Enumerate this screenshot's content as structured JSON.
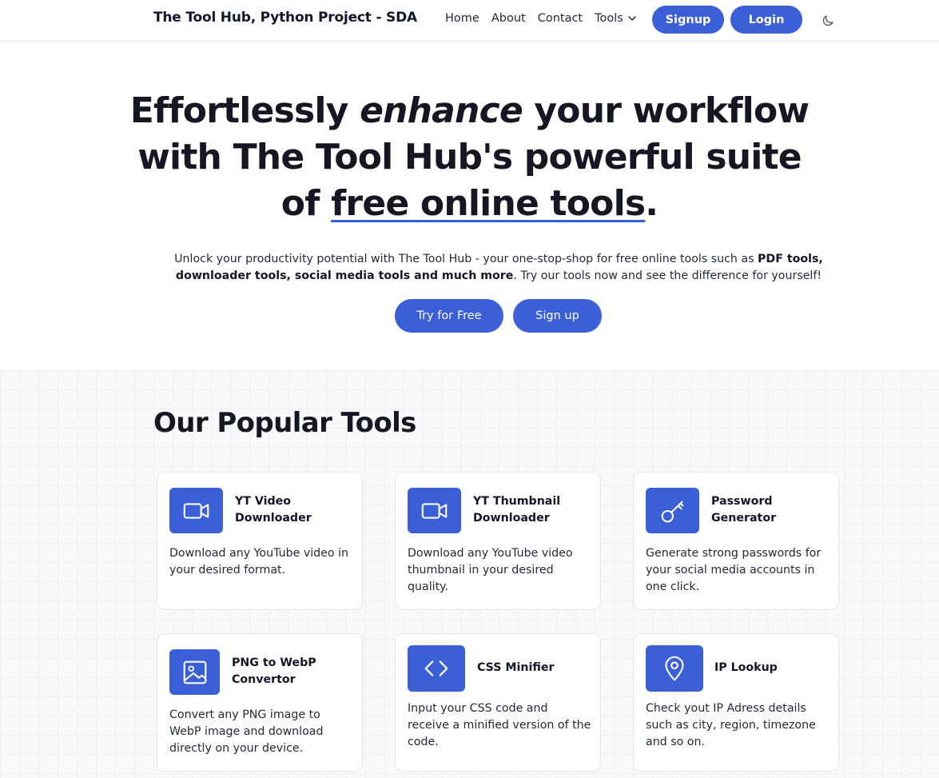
{
  "navbar": {
    "brand": "The Tool Hub, Python Project - SDA",
    "links": [
      "Home",
      "About",
      "Contact"
    ],
    "tools_label": "Tools",
    "signup_label": "Signup",
    "login_label": "Login",
    "theme_icon": "moon-icon"
  },
  "hero": {
    "title_part1": "Effortlessly ",
    "title_em": "enhance",
    "title_part2": " your workflow with The Tool Hub's powerful suite of ",
    "title_underlined": "free online tools",
    "title_end": ".",
    "sub_part1": "Unlock your productivity potential with The Tool Hub - your one-stop-shop for free online tools such as ",
    "sub_bold1": "PDF tools,",
    "sub_bold2": "downloader tools, social media tools and much more",
    "sub_part2": ". Try our tools now and see the difference for yourself!",
    "btn_try": "Try for Free",
    "btn_signup": "Sign up"
  },
  "tools": {
    "heading": "Our Popular Tools",
    "items": [
      {
        "title": "YT Video Downloader",
        "desc": "Download any YouTube video in your desired format.",
        "icon": "video-camera-icon"
      },
      {
        "title": "YT Thumbnail Downloader",
        "desc": "Download any YouTube video thumbnail in your desired quality.",
        "icon": "video-camera-icon"
      },
      {
        "title": "Password Generator",
        "desc": "Generate strong passwords for your social media accounts in one click.",
        "icon": "key-icon"
      },
      {
        "title": "PNG to WebP Convertor",
        "desc": "Convert any PNG image to WebP image and download directly on your device.",
        "icon": "image-icon"
      },
      {
        "title": "CSS Minifier",
        "desc": "Input your CSS code and receive a minified version of the code.",
        "icon": "code-icon"
      },
      {
        "title": "IP Lookup",
        "desc": "Check yout IP Adress details such as city, region, timezone and so on.",
        "icon": "location-pin-icon"
      }
    ]
  },
  "colors": {
    "accent": "#3b5fd6",
    "text": "#111827"
  }
}
